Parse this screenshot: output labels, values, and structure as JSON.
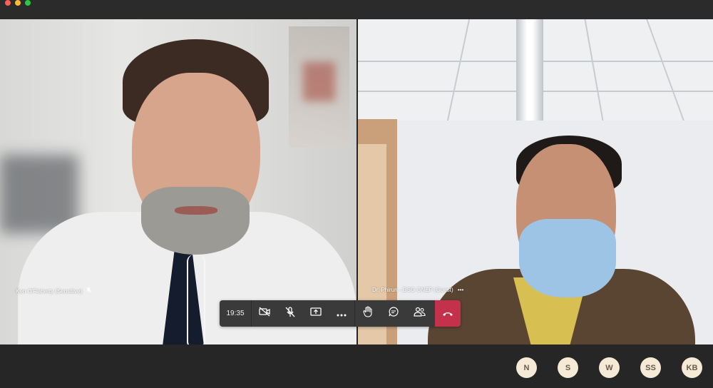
{
  "window": {
    "controls": [
      "close",
      "minimize",
      "maximize"
    ]
  },
  "participants_video": [
    {
      "name": "Ken O'Flaherty (Sensitive)",
      "muted": true
    },
    {
      "name": "Dr. Phirun - DSG ONEP (Guest)",
      "more": "•••"
    }
  ],
  "toolbar": {
    "timer": "19:35",
    "buttons": [
      "video-off-icon",
      "mic-off-icon",
      "share-screen-icon",
      "more-icon",
      "raise-hand-icon",
      "chat-icon",
      "people-icon",
      "hangup-icon"
    ],
    "hangup_color": "#c4314b"
  },
  "avatars": [
    {
      "initials": "N"
    },
    {
      "initials": "S"
    },
    {
      "initials": "W"
    },
    {
      "initials": "SS"
    },
    {
      "initials": "KB"
    }
  ]
}
